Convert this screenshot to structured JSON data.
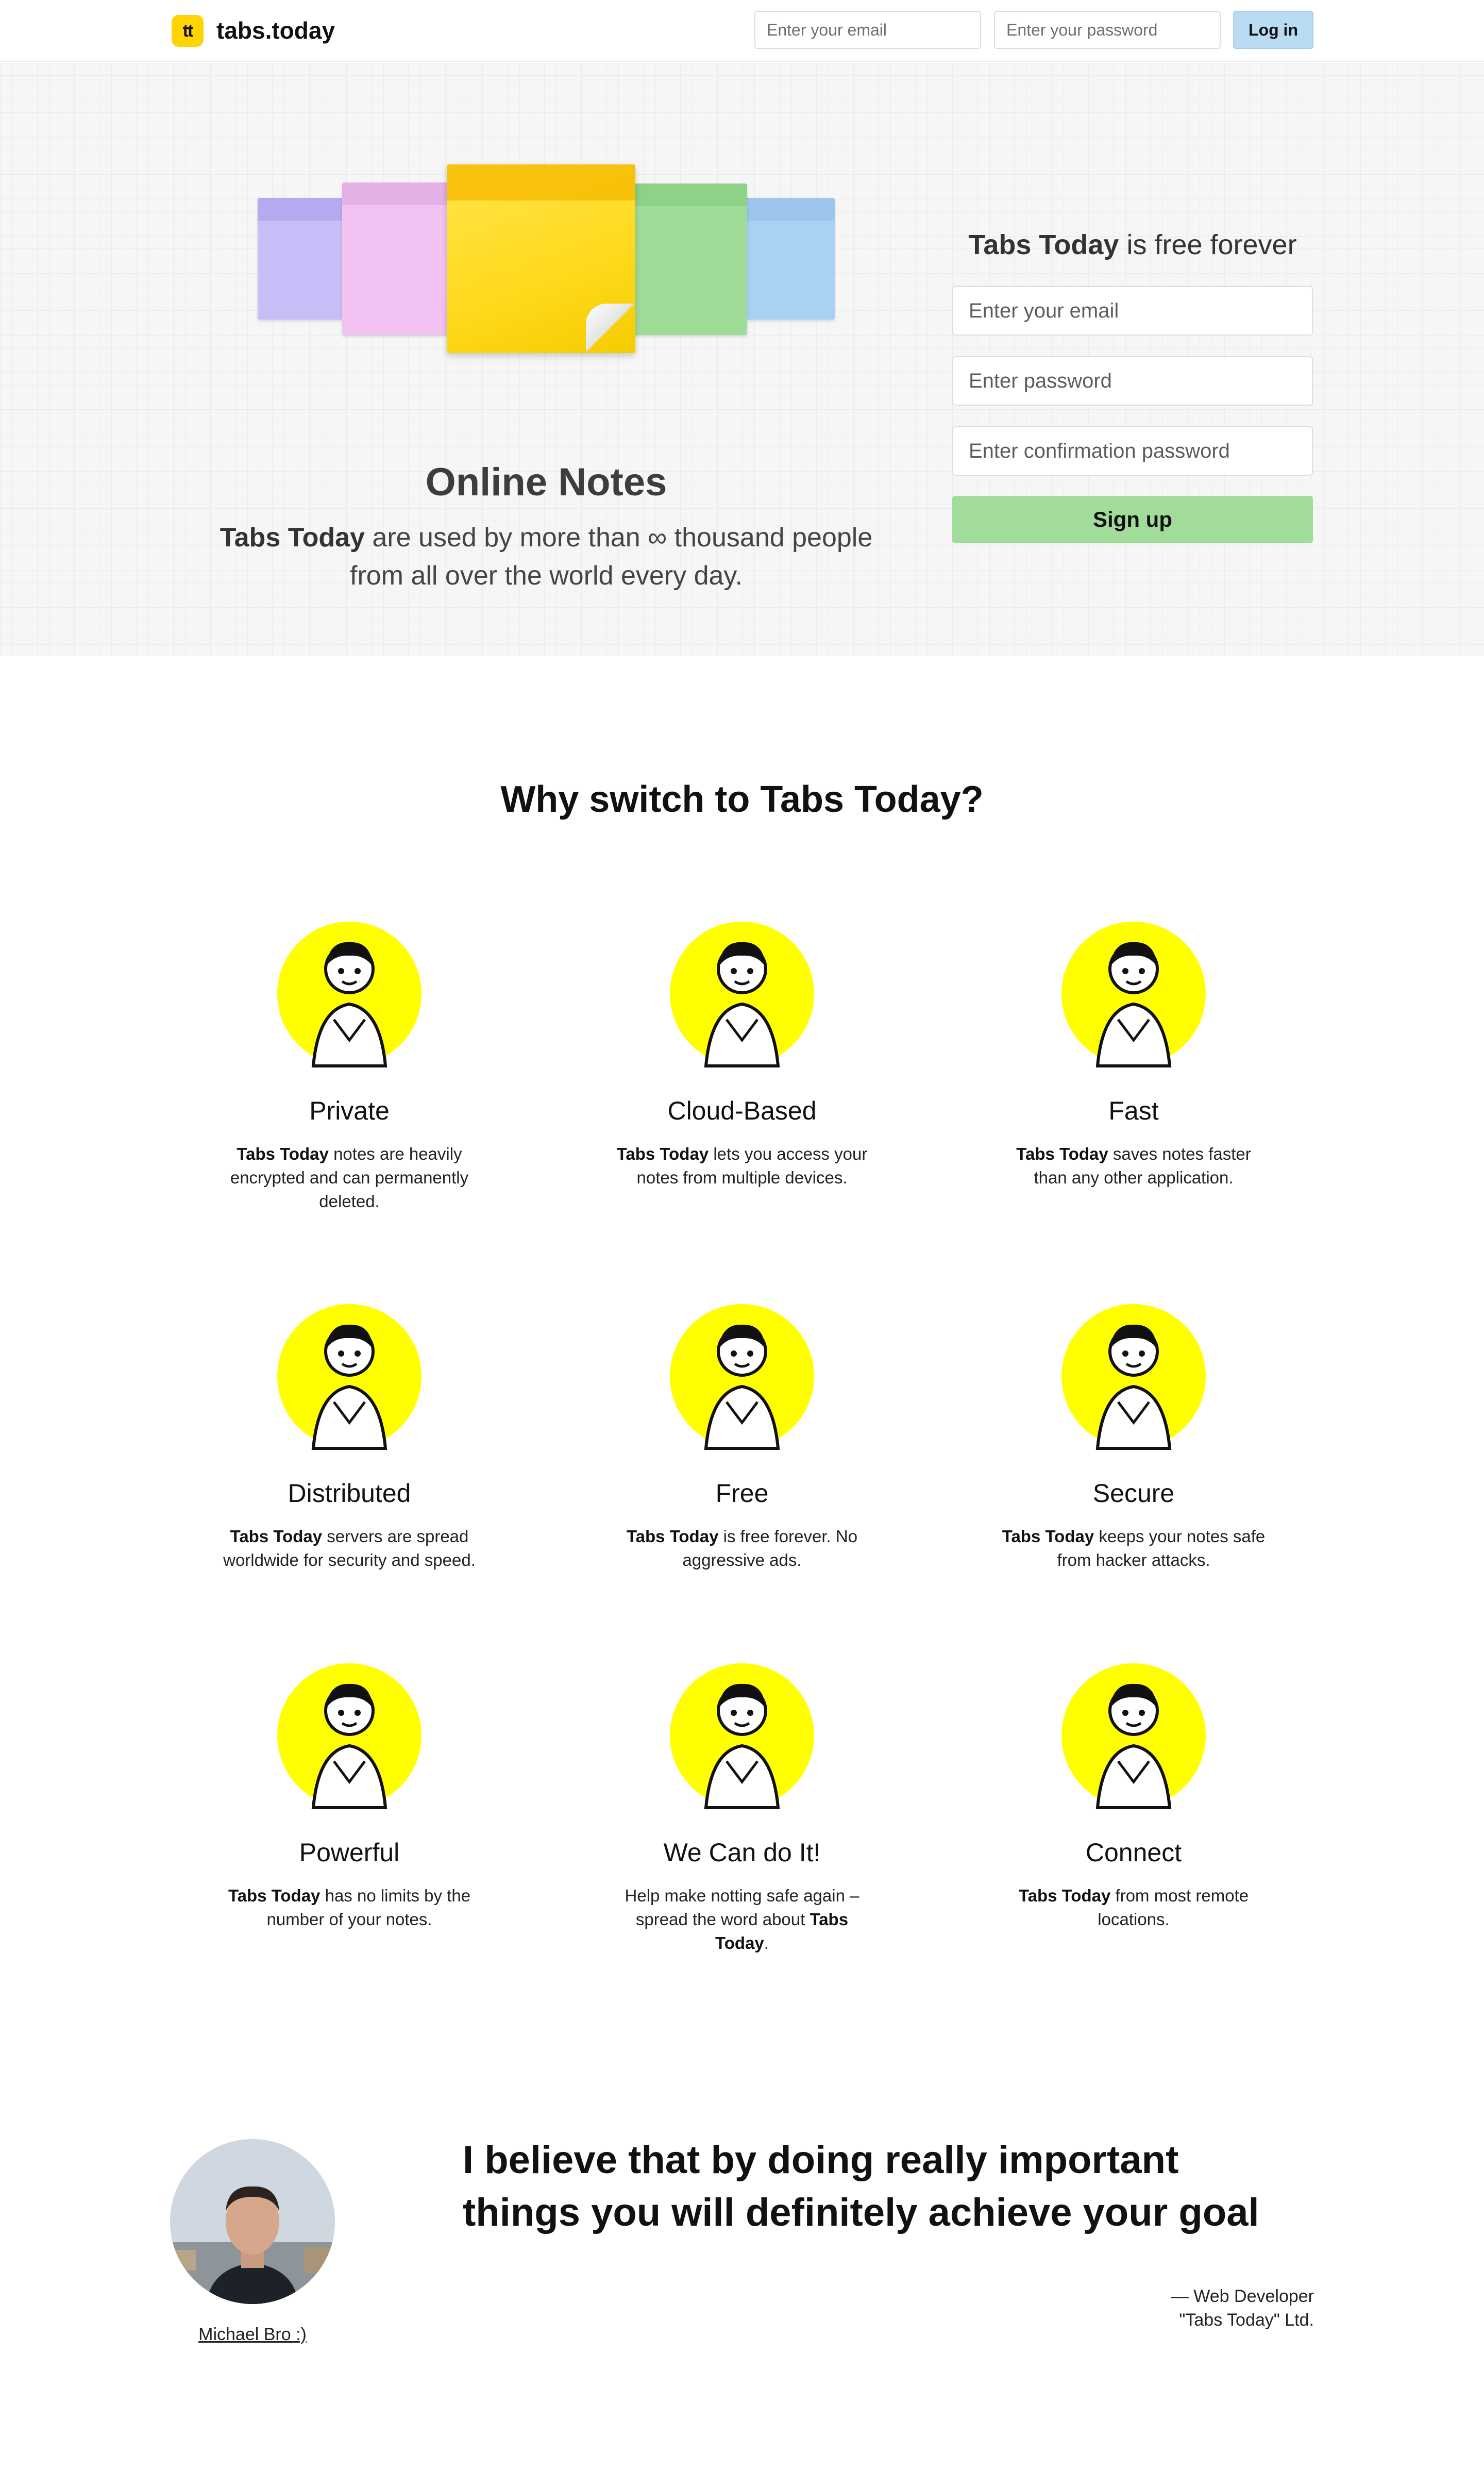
{
  "header": {
    "logo_mark": "tt",
    "brand": "tabs.today",
    "email_placeholder": "Enter your email",
    "password_placeholder": "Enter your password",
    "login_label": "Log in"
  },
  "hero": {
    "title": "Online Notes",
    "sub_brand": "Tabs Today",
    "sub_line1_rest": " are used by more than ∞ thousand people",
    "sub_line2": "from all over the world every day.",
    "note_colors": [
      "#c8bdf7",
      "#f1c2f2",
      "#ffd91c",
      "#9fdc98",
      "#a9d1f4"
    ]
  },
  "signup": {
    "title_brand": "Tabs Today",
    "title_rest": " is free forever",
    "email_placeholder": "Enter your email",
    "password_placeholder": "Enter password",
    "confirm_placeholder": "Enter confirmation password",
    "button_label": "Sign up"
  },
  "features": {
    "title": "Why switch to Tabs Today?",
    "items": [
      {
        "title": "Private",
        "brand": "Tabs Today",
        "desc": " notes are heavily encrypted and can permanently deleted.",
        "icon": "private-illustration-icon"
      },
      {
        "title": "Cloud-Based",
        "brand": "Tabs Today",
        "desc": " lets you access your notes from multiple devices.",
        "icon": "cloud-illustration-icon"
      },
      {
        "title": "Fast",
        "brand": "Tabs Today",
        "desc": " saves notes faster than any other application.",
        "icon": "fast-car-illustration-icon"
      },
      {
        "title": "Distributed",
        "brand": "Tabs Today",
        "desc": " servers are spread worldwide for security and speed.",
        "icon": "distributed-illustration-icon"
      },
      {
        "title": "Free",
        "brand": "Tabs Today",
        "desc": " is free forever. No aggressive ads.",
        "icon": "free-illustration-icon"
      },
      {
        "title": "Secure",
        "brand": "Tabs Today",
        "desc": " keeps your notes safe from hacker attacks.",
        "icon": "secure-illustration-icon"
      },
      {
        "title": "Powerful",
        "brand": "Tabs Today",
        "desc": " has no limits by the number of your notes.",
        "icon": "powerful-illustration-icon"
      },
      {
        "title": "We Can do It!",
        "pre": "Help make notting safe again – spread the word about ",
        "brand": "Tabs Today",
        "post": ".",
        "icon": "megaphone-illustration-icon"
      },
      {
        "title": "Connect",
        "brand": "Tabs Today",
        "desc": " from most remote locations.",
        "icon": "connect-illustration-icon"
      }
    ]
  },
  "testimonial": {
    "author": "Michael Bro :)",
    "quote_line1": "I believe that by doing really important",
    "quote_line2": "things you will definitely achieve your goal",
    "attr_line1": "— Web Developer",
    "attr_line2": "\"Tabs Today\" Ltd."
  },
  "colors": {
    "brand_yellow": "#ffd400",
    "illustration_yellow": "#ffff00",
    "signup_green": "#a1dc9b",
    "login_blue": "#b9dcf3"
  }
}
